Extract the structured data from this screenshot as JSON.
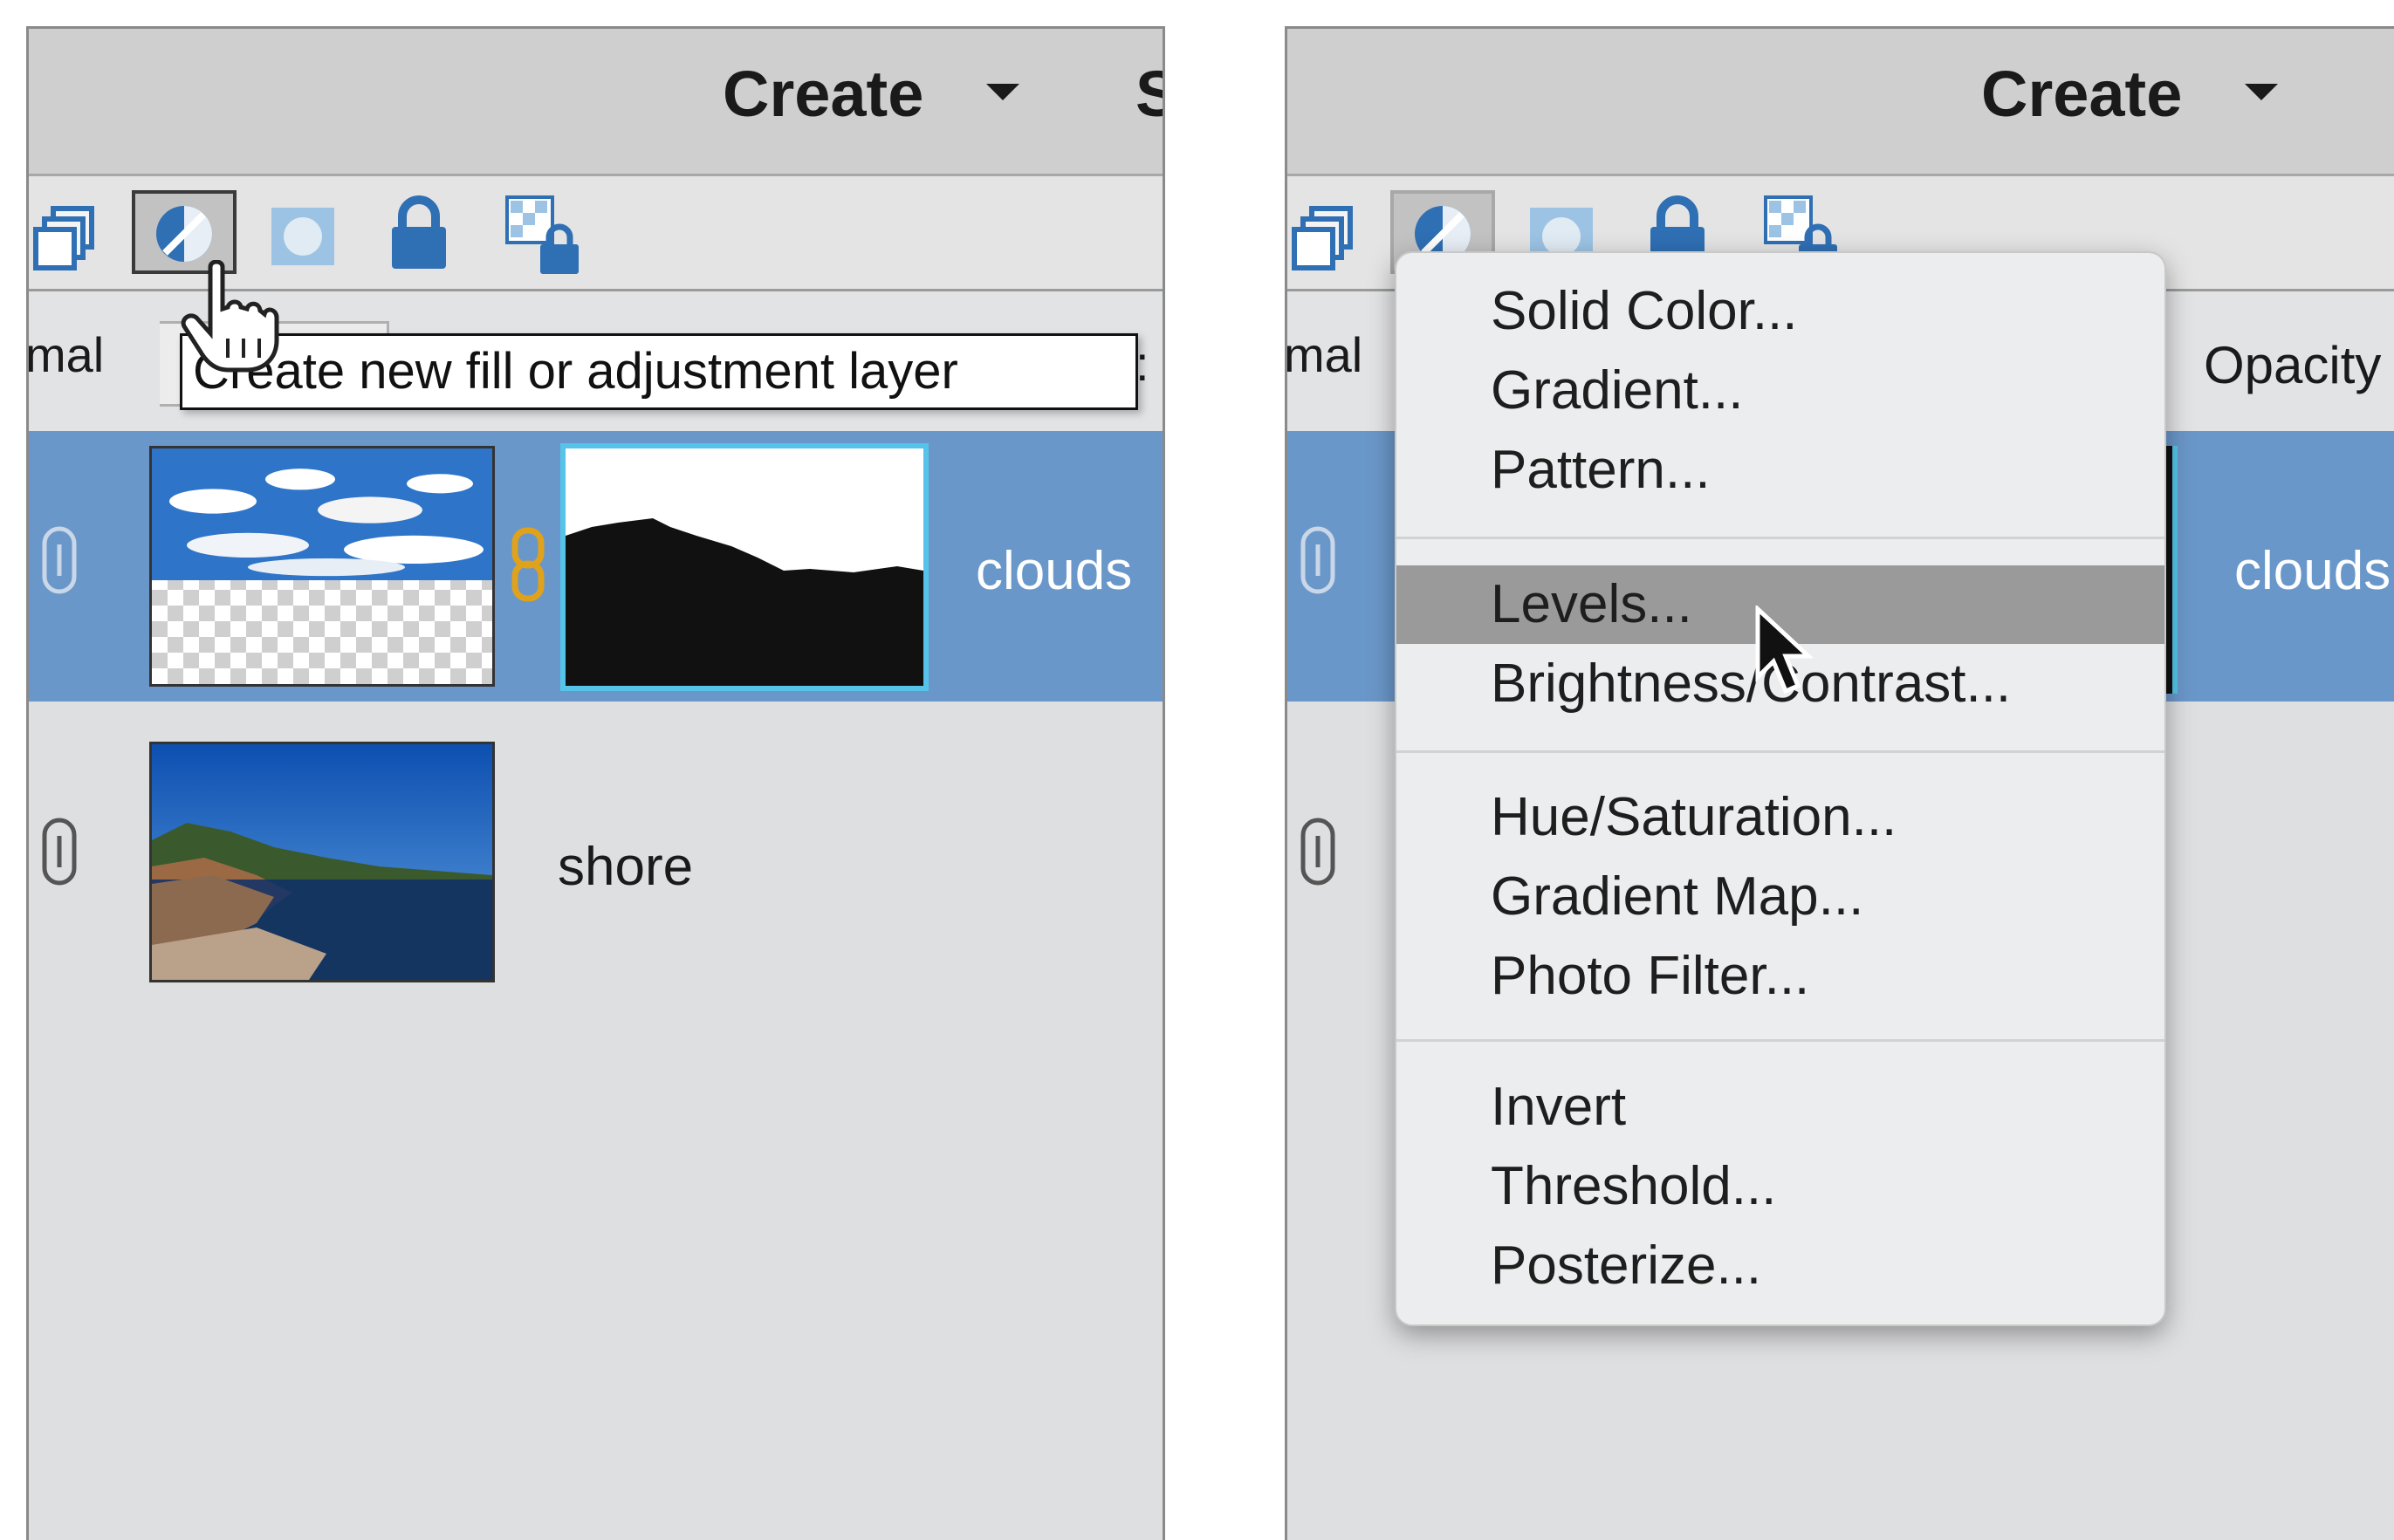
{
  "left_panel": {
    "create_label": "Create",
    "cut_label": "S",
    "blend_mode_partial": "mal",
    "opacity_partial": "y:",
    "tooltip": "Create new fill or adjustment layer",
    "layers": [
      {
        "name": "clouds",
        "selected": true,
        "has_mask": true
      },
      {
        "name": "shore",
        "selected": false,
        "has_mask": false
      }
    ]
  },
  "right_panel": {
    "create_label": "Create",
    "blend_mode_partial": "mal",
    "opacity_label": "Opacity",
    "layers": [
      {
        "name": "clouds",
        "selected": true
      }
    ],
    "menu": {
      "groups": [
        [
          "Solid Color...",
          "Gradient...",
          "Pattern..."
        ],
        [
          "Levels...",
          "Brightness/Contrast..."
        ],
        [
          "Hue/Saturation...",
          "Gradient Map...",
          "Photo Filter..."
        ],
        [
          "Invert",
          "Threshold...",
          "Posterize..."
        ]
      ],
      "highlighted": "Levels..."
    }
  },
  "icons": [
    "duplicate-layers-icon",
    "fill-adjustment-layer-icon",
    "add-layer-mask-icon",
    "lock-all-icon",
    "lock-transparent-icon"
  ],
  "colors": {
    "selected_row": "#6a97c9",
    "mask_border": "#55c3ea",
    "icon_blue": "#2f6fb3",
    "menu_highlight": "#9a9a9a"
  }
}
